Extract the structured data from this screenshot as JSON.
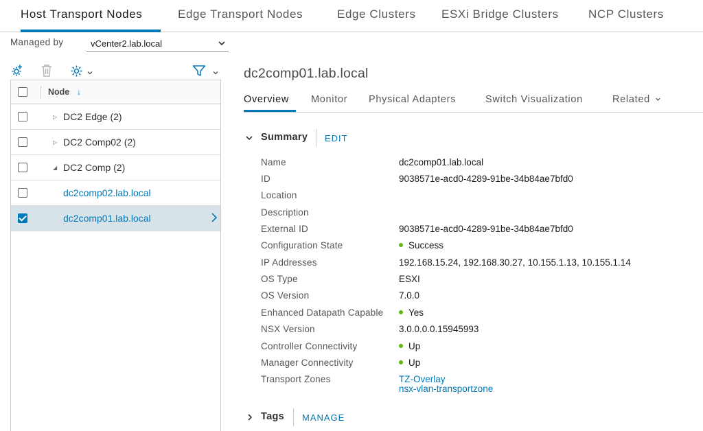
{
  "top_tabs": [
    {
      "label": "Host Transport Nodes"
    },
    {
      "label": "Edge Transport Nodes"
    },
    {
      "label": "Edge Clusters"
    },
    {
      "label": "ESXi Bridge Clusters"
    },
    {
      "label": "NCP Clusters"
    }
  ],
  "managed_by": {
    "label": "Managed by",
    "value": "vCenter2.lab.local"
  },
  "toolbar": {
    "icons": [
      "add-gear-icon",
      "trash-icon",
      "gear-icon",
      "filter-icon"
    ]
  },
  "grid": {
    "header": {
      "label": "Node",
      "sort": "descending"
    },
    "rows": [
      {
        "label": "DC2 Edge (2)",
        "type": "group",
        "expanded": false,
        "checked": false
      },
      {
        "label": "DC2 Comp02 (2)",
        "type": "group",
        "expanded": false,
        "checked": false
      },
      {
        "label": "DC2 Comp (2)",
        "type": "group",
        "expanded": true,
        "checked": false
      },
      {
        "label": "dc2comp02.lab.local",
        "type": "host",
        "checked": false
      },
      {
        "label": "dc2comp01.lab.local",
        "type": "host",
        "checked": true
      }
    ]
  },
  "detail": {
    "title": "dc2comp01.lab.local",
    "tabs": [
      {
        "label": "Overview"
      },
      {
        "label": "Monitor"
      },
      {
        "label": "Physical Adapters"
      },
      {
        "label": "Switch Visualization"
      },
      {
        "label": "Related"
      }
    ],
    "summary": {
      "title": "Summary",
      "action": "EDIT",
      "properties": [
        {
          "label": "Name",
          "value": "dc2comp01.lab.local"
        },
        {
          "label": "ID",
          "value": "9038571e-acd0-4289-91be-34b84ae7bfd0"
        },
        {
          "label": "Location",
          "value": ""
        },
        {
          "label": "Description",
          "value": ""
        },
        {
          "label": "External ID",
          "value": "9038571e-acd0-4289-91be-34b84ae7bfd0"
        },
        {
          "label": "Configuration State",
          "value": "Success"
        },
        {
          "label": "IP Addresses",
          "value": "192.168.15.24, 192.168.30.27, 10.155.1.13, 10.155.1.14"
        },
        {
          "label": "OS Type",
          "value": "ESXI"
        },
        {
          "label": "OS Version",
          "value": "7.0.0"
        },
        {
          "label": "Enhanced Datapath Capable",
          "value": "Yes"
        },
        {
          "label": "NSX Version",
          "value": "3.0.0.0.0.15945993"
        },
        {
          "label": "Controller Connectivity",
          "value": "Up"
        },
        {
          "label": "Manager Connectivity",
          "value": "Up"
        },
        {
          "label": "Transport Zones",
          "value": ""
        }
      ],
      "transport_zones": [
        "TZ-Overlay",
        "nsx-vlan-transportzone"
      ]
    },
    "tags": {
      "title": "Tags",
      "action": "MANAGE"
    }
  },
  "colors": {
    "accent": "#0079b8",
    "status_ok": "#5eb715",
    "selected_row": "#d8e3e9"
  }
}
